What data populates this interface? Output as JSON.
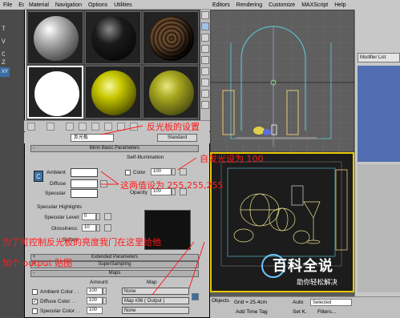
{
  "max": {
    "menus_left": [
      "File",
      "Edit"
    ],
    "menus_right": [
      "Editors",
      "Rendering",
      "Customize",
      "MAXScript",
      "Help"
    ],
    "left_strip_letters": [
      "T",
      "V",
      "C",
      "Z"
    ],
    "axis_badge": "XY",
    "modifier_list": "Modifier List",
    "status": {
      "grid_label": "Grid = 25.4cm",
      "auto_label": "Auto",
      "selected_value": "Selected",
      "set_key": "Set K.",
      "filters": "Filters...",
      "add_time_tag": "Add Time Tag",
      "objects": "Objects"
    }
  },
  "mat_editor": {
    "menus": [
      "Material",
      "Navigation",
      "Options",
      "Utilities"
    ],
    "material_name": "反光板",
    "type_button": "Standard",
    "rollouts": {
      "blinn": "Blinn Basic Parameters",
      "self_illum": "Self-Illumination",
      "specular_highlights": "Specular Highlights",
      "extended": "Extended Parameters",
      "supersampling": "SuperSampling",
      "maps": "Maps"
    },
    "params": {
      "ambient": "Ambient",
      "diffuse": "Diffuse",
      "specular": "Specular",
      "color": "Color",
      "color_value": "100",
      "opacity": "Opacity",
      "opacity_value": "100",
      "specular_level": "Specular Level:",
      "specular_level_value": "0",
      "glossiness": "Glossiness:",
      "glossiness_value": "10",
      "soften": "Soften"
    },
    "maps": {
      "amount_header": "Amount",
      "map_header": "Map",
      "rows": [
        {
          "label": "Ambient Color . .",
          "amount": "100",
          "map": "None"
        },
        {
          "label": "Diffuse Color . .",
          "amount": "100",
          "map": "Map #36  ( Output )"
        },
        {
          "label": "Specular Color . .",
          "amount": "100",
          "map": "None"
        }
      ]
    }
  },
  "annotations": {
    "title": "反光板的设置",
    "self_illum": "自发光设为 100",
    "color_values": "这两值设为 255,255,255",
    "output_line1": "为了可控制反光板的亮度我门在这里给他",
    "output_line2": "加个 output 贴图"
  },
  "watermark": {
    "title": "百科全说",
    "subtitle": "助你轻松解决"
  },
  "colors": {
    "annotation": "#ff1a1a",
    "viewport_active": "#e8c800",
    "stack": "#4f6db0"
  }
}
